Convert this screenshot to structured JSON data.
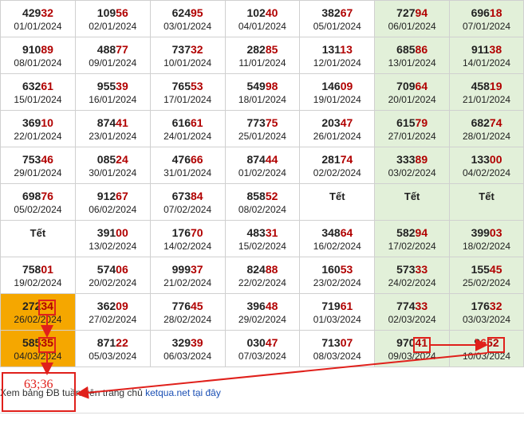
{
  "table": {
    "rows": [
      [
        {
          "head": "429",
          "tail": "32",
          "date": "01/01/2024"
        },
        {
          "head": "109",
          "tail": "56",
          "date": "02/01/2024"
        },
        {
          "head": "624",
          "tail": "95",
          "date": "03/01/2024"
        },
        {
          "head": "102",
          "tail": "40",
          "date": "04/01/2024"
        },
        {
          "head": "382",
          "tail": "67",
          "date": "05/01/2024"
        },
        {
          "head": "727",
          "tail": "94",
          "date": "06/01/2024",
          "weekend": true
        },
        {
          "head": "696",
          "tail": "18",
          "date": "07/01/2024",
          "weekend": true
        }
      ],
      [
        {
          "head": "910",
          "tail": "89",
          "date": "08/01/2024"
        },
        {
          "head": "488",
          "tail": "77",
          "date": "09/01/2024"
        },
        {
          "head": "737",
          "tail": "32",
          "date": "10/01/2024"
        },
        {
          "head": "282",
          "tail": "85",
          "date": "11/01/2024"
        },
        {
          "head": "131",
          "tail": "13",
          "date": "12/01/2024"
        },
        {
          "head": "685",
          "tail": "86",
          "date": "13/01/2024",
          "weekend": true
        },
        {
          "head": "911",
          "tail": "38",
          "date": "14/01/2024",
          "weekend": true
        }
      ],
      [
        {
          "head": "632",
          "tail": "61",
          "date": "15/01/2024"
        },
        {
          "head": "955",
          "tail": "39",
          "date": "16/01/2024"
        },
        {
          "head": "765",
          "tail": "53",
          "date": "17/01/2024"
        },
        {
          "head": "549",
          "tail": "98",
          "date": "18/01/2024"
        },
        {
          "head": "146",
          "tail": "09",
          "date": "19/01/2024"
        },
        {
          "head": "709",
          "tail": "64",
          "date": "20/01/2024",
          "weekend": true
        },
        {
          "head": "458",
          "tail": "19",
          "date": "21/01/2024",
          "weekend": true
        }
      ],
      [
        {
          "head": "369",
          "tail": "10",
          "date": "22/01/2024"
        },
        {
          "head": "874",
          "tail": "41",
          "date": "23/01/2024"
        },
        {
          "head": "616",
          "tail": "61",
          "date": "24/01/2024"
        },
        {
          "head": "773",
          "tail": "75",
          "date": "25/01/2024"
        },
        {
          "head": "203",
          "tail": "47",
          "date": "26/01/2024"
        },
        {
          "head": "615",
          "tail": "79",
          "date": "27/01/2024",
          "weekend": true
        },
        {
          "head": "682",
          "tail": "74",
          "date": "28/01/2024",
          "weekend": true
        }
      ],
      [
        {
          "head": "753",
          "tail": "46",
          "date": "29/01/2024"
        },
        {
          "head": "085",
          "tail": "24",
          "date": "30/01/2024"
        },
        {
          "head": "476",
          "tail": "66",
          "date": "31/01/2024"
        },
        {
          "head": "874",
          "tail": "44",
          "date": "01/02/2024"
        },
        {
          "head": "281",
          "tail": "74",
          "date": "02/02/2024"
        },
        {
          "head": "333",
          "tail": "89",
          "date": "03/02/2024",
          "weekend": true
        },
        {
          "head": "133",
          "tail": "00",
          "date": "04/02/2024",
          "weekend": true
        }
      ],
      [
        {
          "head": "698",
          "tail": "76",
          "date": "05/02/2024"
        },
        {
          "head": "912",
          "tail": "67",
          "date": "06/02/2024"
        },
        {
          "head": "673",
          "tail": "84",
          "date": "07/02/2024"
        },
        {
          "head": "858",
          "tail": "52",
          "date": "08/02/2024"
        },
        {
          "tet": "Tết"
        },
        {
          "tet": "Tết",
          "weekend": true
        },
        {
          "tet": "Tết",
          "weekend": true
        }
      ],
      [
        {
          "tet": "Tết"
        },
        {
          "head": "391",
          "tail": "00",
          "date": "13/02/2024"
        },
        {
          "head": "176",
          "tail": "70",
          "date": "14/02/2024"
        },
        {
          "head": "483",
          "tail": "31",
          "date": "15/02/2024"
        },
        {
          "head": "348",
          "tail": "64",
          "date": "16/02/2024"
        },
        {
          "head": "582",
          "tail": "94",
          "date": "17/02/2024",
          "weekend": true
        },
        {
          "head": "399",
          "tail": "03",
          "date": "18/02/2024",
          "weekend": true
        }
      ],
      [
        {
          "head": "758",
          "tail": "01",
          "date": "19/02/2024"
        },
        {
          "head": "574",
          "tail": "06",
          "date": "20/02/2024"
        },
        {
          "head": "999",
          "tail": "37",
          "date": "21/02/2024"
        },
        {
          "head": "824",
          "tail": "88",
          "date": "22/02/2024"
        },
        {
          "head": "160",
          "tail": "53",
          "date": "23/02/2024"
        },
        {
          "head": "573",
          "tail": "33",
          "date": "24/02/2024",
          "weekend": true
        },
        {
          "head": "155",
          "tail": "45",
          "date": "25/02/2024",
          "weekend": true
        }
      ],
      [
        {
          "head": "272",
          "tail": "34",
          "date": "26/02/2024",
          "hl": true
        },
        {
          "head": "362",
          "tail": "09",
          "date": "27/02/2024"
        },
        {
          "head": "776",
          "tail": "45",
          "date": "28/02/2024"
        },
        {
          "head": "396",
          "tail": "48",
          "date": "29/02/2024"
        },
        {
          "head": "719",
          "tail": "61",
          "date": "01/03/2024"
        },
        {
          "head": "774",
          "tail": "33",
          "date": "02/03/2024",
          "weekend": true
        },
        {
          "head": "176",
          "tail": "32",
          "date": "03/03/2024",
          "weekend": true
        }
      ],
      [
        {
          "head": "585",
          "tail": "35",
          "date": "04/03/2024",
          "hl": true
        },
        {
          "head": "871",
          "tail": "22",
          "date": "05/03/2024"
        },
        {
          "head": "329",
          "tail": "39",
          "date": "06/03/2024"
        },
        {
          "head": "030",
          "tail": "47",
          "date": "07/03/2024"
        },
        {
          "head": "713",
          "tail": "07",
          "date": "08/03/2024"
        },
        {
          "head": "970",
          "tail": "41",
          "date": "09/03/2024",
          "weekend": true
        },
        {
          "head": "9",
          "tail": "52",
          "date": "10/03/2024",
          "weekend": true,
          "gap": "6"
        }
      ]
    ]
  },
  "annotation": {
    "result": "63;36",
    "color": "#e0201b"
  },
  "footer": {
    "prefix": "Xem bảng ĐB tuần trên trang chủ",
    "link_text": "ketqua.net tại đây"
  }
}
